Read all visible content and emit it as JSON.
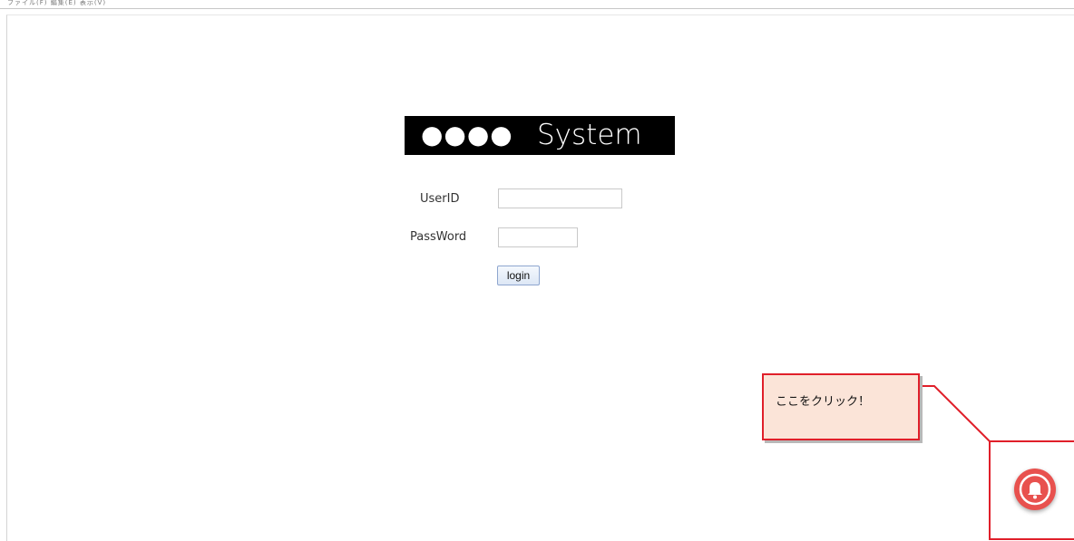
{
  "window": {
    "top_bar_text": "ファイル(F) 編集(E) 表示(V)"
  },
  "logo": {
    "dots": "●●●●",
    "text": "System"
  },
  "form": {
    "userid_label": "UserID",
    "userid_value": "",
    "password_label": "PassWord",
    "password_value": "",
    "login_label": "login"
  },
  "annotation": {
    "callout_text": "ここをクリック！",
    "accent_color": "#e01f2a",
    "callout_fill": "#fbe4d8"
  },
  "notification": {
    "icon": "bell-icon",
    "color": "#e8514e"
  }
}
